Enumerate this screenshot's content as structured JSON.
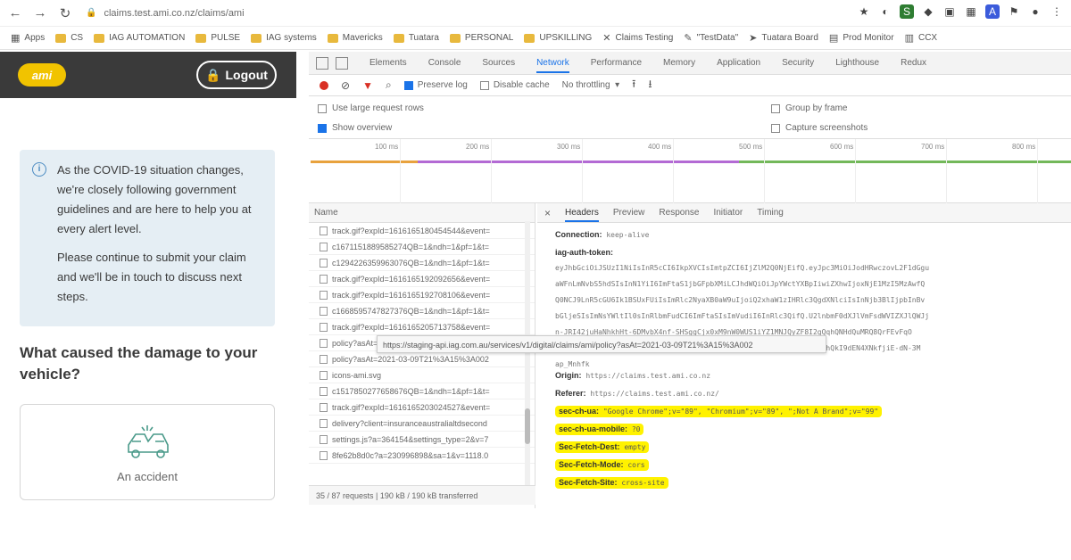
{
  "browser": {
    "url": "claims.test.ami.co.nz/claims/ami",
    "bookmarks": [
      {
        "label": "Apps",
        "kind": "apps"
      },
      {
        "label": "CS",
        "kind": "folder"
      },
      {
        "label": "IAG AUTOMATION",
        "kind": "folder"
      },
      {
        "label": "PULSE",
        "kind": "folder"
      },
      {
        "label": "IAG systems",
        "kind": "folder"
      },
      {
        "label": "Mavericks",
        "kind": "folder"
      },
      {
        "label": "Tuatara",
        "kind": "folder"
      },
      {
        "label": "PERSONAL",
        "kind": "folder"
      },
      {
        "label": "UPSKILLING",
        "kind": "folder"
      },
      {
        "label": "Claims Testing",
        "kind": "x"
      },
      {
        "label": "\"TestData\"",
        "kind": "quote"
      },
      {
        "label": "Tuatara Board",
        "kind": "pin"
      },
      {
        "label": "Prod Monitor",
        "kind": "monitor"
      },
      {
        "label": "CCX",
        "kind": "ccx"
      }
    ]
  },
  "app": {
    "logo": "ami",
    "logout_label": "Logout",
    "notice_p1": "As the COVID-19 situation changes, we're closely following government guidelines and are here to help you at every alert level.",
    "notice_p2": "Please continue to submit your claim and we'll be in touch to discuss next steps.",
    "question": "What caused the damage to your vehicle?",
    "option_label": "An accident"
  },
  "devtools": {
    "tabs": [
      "Elements",
      "Console",
      "Sources",
      "Network",
      "Performance",
      "Memory",
      "Application",
      "Security",
      "Lighthouse",
      "Redux"
    ],
    "active_tab": "Network",
    "preserve_log": "Preserve log",
    "disable_cache": "Disable cache",
    "throttling": "No throttling",
    "large_rows": "Use large request rows",
    "show_overview": "Show overview",
    "group_by_frame": "Group by frame",
    "capture_screenshots": "Capture screenshots",
    "ticks": [
      "100 ms",
      "200 ms",
      "300 ms",
      "400 ms",
      "500 ms",
      "600 ms",
      "700 ms",
      "800 ms"
    ],
    "list_header": "Name",
    "requests": [
      "track.gif?expId=1616165180454544&event=",
      "c1671151889585274QB=1&ndh=1&pf=1&t=",
      "c1294226359963076QB=1&ndh=1&pf=1&t=",
      "track.gif?expId=1616165192092656&event=",
      "track.gif?expId=1616165192708106&event=",
      "c1668595747827376QB=1&ndh=1&pf=1&t=",
      "track.gif?expId=1616165205713758&event=",
      "policy?asAt=2021-03-09T21%3A15%3A002",
      "policy?asAt=2021-03-09T21%3A15%3A002",
      "icons-ami.svg",
      "c1517850277658676QB=1&ndh=1&pf=1&t=",
      "track.gif?expId=1616165203024527&event=",
      "delivery?client=insuranceaustralialtdsecond",
      "settings.js?a=364154&settings_type=2&v=7",
      "8fe62b8d0c?a=230996898&sa=1&v=1118.0"
    ],
    "tooltip": "https://staging-api.iag.com.au/services/v1/digital/claims/ami/policy?asAt=2021-03-09T21%3A15%3A002",
    "footer": "35 / 87 requests | 190 kB / 190 kB transferred",
    "detail_tabs": [
      "Headers",
      "Preview",
      "Response",
      "Initiator",
      "Timing"
    ],
    "active_detail_tab": "Headers",
    "headers": {
      "connection_key": "Connection:",
      "connection_val": "keep-alive",
      "auth_key": "iag-auth-token:",
      "auth_lines": [
        "eyJhbGciOiJSUzI1NiIsInR5cCI6IkpXVCIsImtpZCI6IjZlM2Q0NjEifQ.eyJpc3MiOiJodHRwczovL2F1dGgu",
        "aWFnLmNvbS5hdSIsInN1YiI6ImFtaS1jbGFpbXMiLCJhdWQiOiJpYWctYXBpIiwiZXhwIjoxNjE1MzI5MzAwfQ",
        "Q0NCJ9LnR5cGU6Ik1BSUxFUiIsImRlc2NyaXB0aW9uIjoiQ2xhaW1zIHRlc3QgdXNlciIsInNjb3BlIjpbInBv",
        "bGljeSIsImNsYWltIl0sInRlbmFudCI6ImFtaSIsImVudiI6InRlc3QifQ.U2lnbmF0dXJlVmFsdWVIZXJlQWJj",
        "n-JRI42juHaNhkhHt-6DMvbX4nf-SHSggCjx0xM9nW0WUS1iYZ1MNJQyZF8I2gQqhQNHdQuMRQ8QrFEvFqO",
        "54fpcUx-bF2X4rcPqHUjbgQ3qwRnyG5kdnVs_xoOaBIndMjloX3ps6Q8kHd2vnJhQkI9dEN4XNkfjiE-dN-3M",
        "ap_Mnhfk"
      ],
      "origin_key": "Origin:",
      "origin_val": "https://claims.test.ami.co.nz",
      "referer_key": "Referer:",
      "referer_val": "https://claims.test.ami.co.nz/",
      "secua_key": "sec-ch-ua:",
      "secua_val": "\"Google Chrome\";v=\"89\", \"Chromium\";v=\"89\", \";Not A Brand\";v=\"99\"",
      "mobile_key": "sec-ch-ua-mobile:",
      "mobile_val": "?0",
      "dest_key": "Sec-Fetch-Dest:",
      "dest_val": "empty",
      "mode_key": "Sec-Fetch-Mode:",
      "mode_val": "cors",
      "site_key": "Sec-Fetch-Site:",
      "site_val": "cross-site"
    }
  },
  "colors": {
    "header_bg": "#3a3a3a",
    "logo_yellow": "#f1c300",
    "notice_bg": "#e5eef4",
    "highlight": "#fff200",
    "devtools_accent": "#1a73e8"
  }
}
